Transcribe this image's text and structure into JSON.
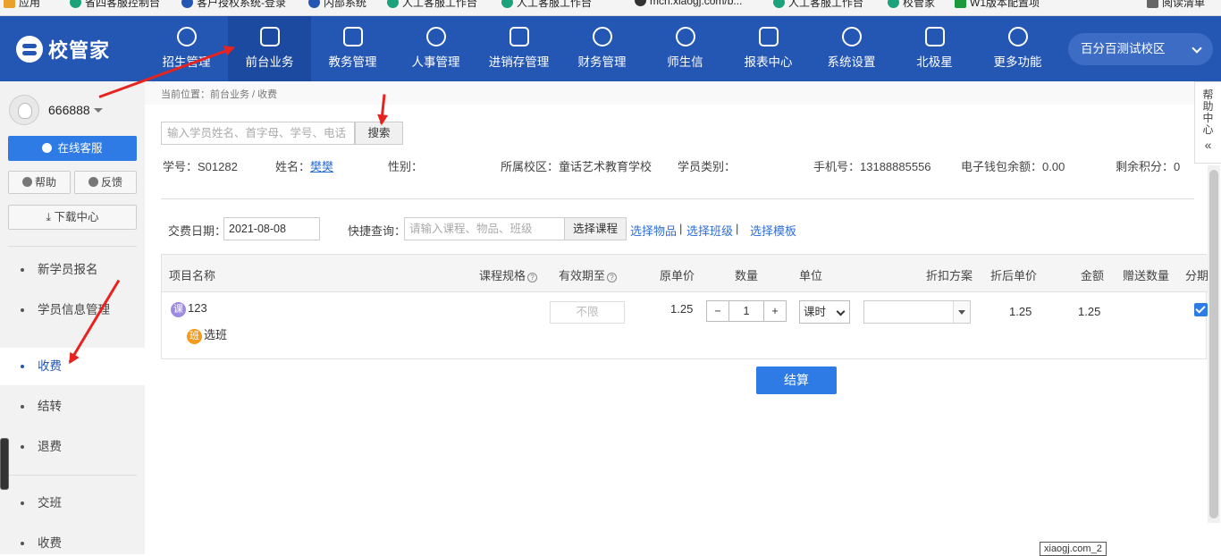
{
  "bookmarks": [
    "应用",
    "省四客服控制台",
    "客户授权系统-登录",
    "内部系统",
    "人工客服工作台",
    "人工客服工作台",
    "mch.xiaogj.com/b...",
    "人工客服工作台",
    "校管家",
    "W1版本配置项",
    "阅读清单"
  ],
  "brand": {
    "logo_text": "校管家",
    "color": "#2456b3"
  },
  "nav": [
    {
      "label": "招生管理",
      "icon": "user-plus-icon"
    },
    {
      "label": "前台业务",
      "icon": "desk-icon"
    },
    {
      "label": "教务管理",
      "icon": "book-icon"
    },
    {
      "label": "人事管理",
      "icon": "person-icon"
    },
    {
      "label": "进销存管理",
      "icon": "inventory-icon"
    },
    {
      "label": "财务管理",
      "icon": "finance-icon"
    },
    {
      "label": "师生信",
      "icon": "chat-icon"
    },
    {
      "label": "报表中心",
      "icon": "report-icon"
    },
    {
      "label": "系统设置",
      "icon": "settings-icon"
    },
    {
      "label": "北极星",
      "icon": "star-icon"
    },
    {
      "label": "更多功能",
      "icon": "more-icon"
    }
  ],
  "campus": "百分百测试校区",
  "sidebar": {
    "username": "666888",
    "online_service": "在线客服",
    "help": "帮助",
    "feedback": "反馈",
    "download": "下载中心",
    "menu": [
      "新学员报名",
      "学员信息管理",
      "收费",
      "结转",
      "退费",
      "交班",
      "收费"
    ]
  },
  "breadcrumb": "当前位置：前台业务 / 收费",
  "search": {
    "placeholder": "输入学员姓名、首字母、学号、电话",
    "button": "搜索"
  },
  "student": {
    "id_label": "学号：S01282",
    "name_label": "姓名：",
    "name": "樊樊",
    "gender": "性别：",
    "campus": "所属校区：童话艺术教育学校",
    "type": "学员类别：",
    "phone": "手机号：13188885556",
    "wallet": "电子钱包余额：0.00",
    "points": "剩余积分：0"
  },
  "payment": {
    "date_label": "交费日期：",
    "date": "2021-08-08",
    "quick_label": "快捷查询：",
    "quick_placeholder": "请输入课程、物品、班级",
    "select_course": "选择课程",
    "select_goods": "选择物品",
    "select_class": "选择班级",
    "select_template": "选择模板",
    "separator": "|"
  },
  "table": {
    "headers": [
      "项目名称",
      "课程规格",
      "有效期至",
      "原单价",
      "数量",
      "单位",
      "折扣方案",
      "折后单价",
      "金额",
      "赠送数量",
      "分期"
    ],
    "row": {
      "course_badge": "课",
      "course_name": "123",
      "class_badge": "班",
      "class_select": "选班",
      "valid_until": "不限",
      "unit_price": "1.25",
      "qty_minus": "−",
      "quantity": "1",
      "qty_plus": "+",
      "unit": "课时",
      "discounted_price": "1.25",
      "amount": "1.25",
      "installment_checked": true
    }
  },
  "settle_button": "结算",
  "help_tab": {
    "text": "帮助中心",
    "collapse": "«"
  },
  "tooltip": "xiaogj.com_2"
}
